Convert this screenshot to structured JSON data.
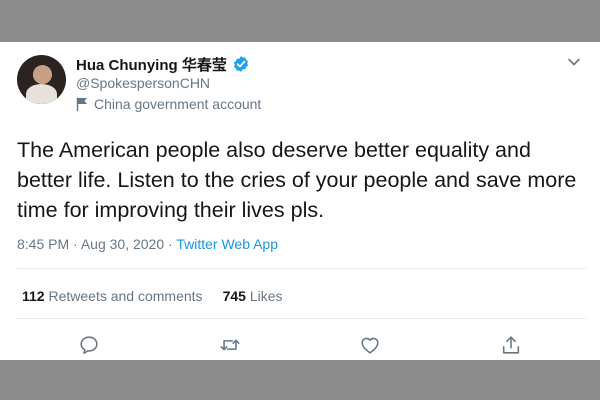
{
  "tweet": {
    "author_name": "Hua Chunying 华春莹",
    "handle": "@SpokespersonCHN",
    "account_label": "China government account",
    "text": "The American people also deserve better equality and better life. Listen to the cries of your people and save more time for improving their lives pls.",
    "time": "8:45 PM",
    "date": "Aug 30, 2020",
    "separator": "·",
    "source_app": "Twitter Web App"
  },
  "stats": {
    "retweets_count": "112",
    "retweets_label": "Retweets and comments",
    "likes_count": "745",
    "likes_label": "Likes"
  },
  "icons": {
    "verified": "verified-badge-icon",
    "account_flag": "flag-icon",
    "menu": "chevron-down-icon",
    "reply": "reply-icon",
    "retweet": "retweet-icon",
    "like": "heart-icon",
    "share": "share-icon"
  },
  "colors": {
    "text_primary": "#14171a",
    "text_secondary": "#657786",
    "link": "#1b95e0",
    "verified_badge": "#1da1f2",
    "divider": "#e6ecf0",
    "outer_background": "#8c8c8c"
  }
}
